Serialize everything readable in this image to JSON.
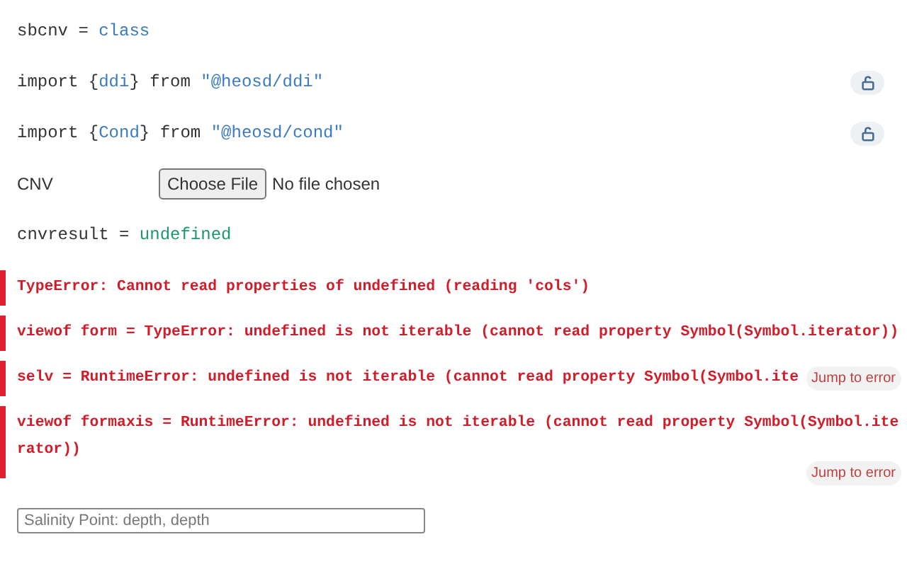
{
  "cells": [
    {
      "kind": "code",
      "segments": [
        {
          "text": "sbcnv = ",
          "kind": "plain"
        },
        {
          "text": "class",
          "kind": "keyword"
        }
      ],
      "locked": false
    },
    {
      "kind": "code",
      "segments": [
        {
          "text": "import {",
          "kind": "plain"
        },
        {
          "text": "ddi",
          "kind": "keyword"
        },
        {
          "text": "} from ",
          "kind": "plain"
        },
        {
          "text": "\"@heosd/ddi\"",
          "kind": "keyword"
        }
      ],
      "locked": true
    },
    {
      "kind": "code",
      "segments": [
        {
          "text": "import {",
          "kind": "plain"
        },
        {
          "text": "Cond",
          "kind": "keyword"
        },
        {
          "text": "} from ",
          "kind": "plain"
        },
        {
          "text": "\"@heosd/cond\"",
          "kind": "keyword"
        }
      ],
      "locked": true
    },
    {
      "kind": "file",
      "label": "CNV",
      "button": "Choose File",
      "status": "No file chosen"
    },
    {
      "kind": "code",
      "segments": [
        {
          "text": "cnvresult = ",
          "kind": "plain"
        },
        {
          "text": "undefined",
          "kind": "value"
        }
      ],
      "locked": false
    },
    {
      "kind": "error",
      "text": "TypeError: Cannot read properties of undefined (reading 'cols')"
    },
    {
      "kind": "error",
      "text": "viewof form = TypeError: undefined is not iterable (cannot read property Symbol(Symbol.iterator))"
    },
    {
      "kind": "error",
      "text": "selv = RuntimeError: undefined is not iterable (cannot read property Symbol(Symbol.ite",
      "jump": "Jump to error"
    },
    {
      "kind": "error",
      "text": "viewof formaxis = RuntimeError: undefined is not iterable (cannot read property Symbol(Symbol.iterator))",
      "jump_below": "Jump to error"
    },
    {
      "kind": "input",
      "placeholder": "Salinity Point: depth, depth"
    }
  ]
}
